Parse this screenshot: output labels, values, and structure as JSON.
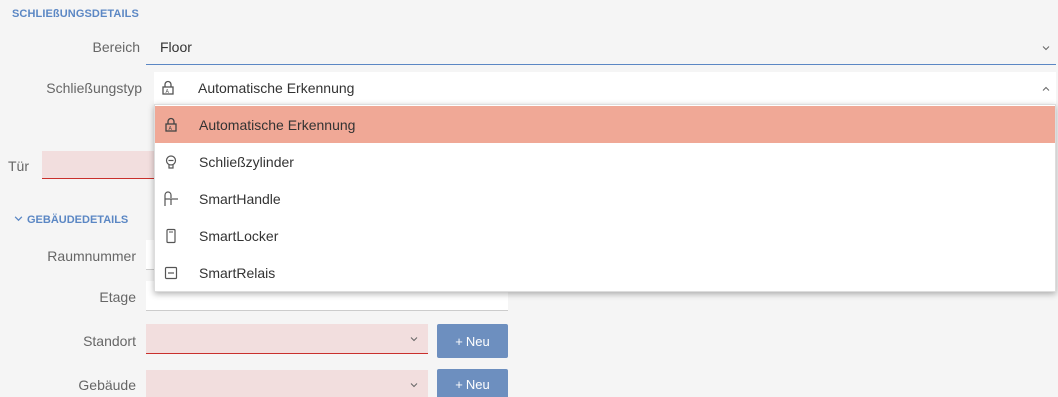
{
  "section_title": "SCHLIEßUNGSDETAILS",
  "bereich": {
    "label": "Bereich",
    "value": "Floor"
  },
  "schliessungstyp": {
    "label": "Schließungstyp",
    "value": "Automatische Erkennung"
  },
  "tuer": {
    "label": "Tür"
  },
  "gebaeudedetails": {
    "title": "GEBÄUDEDETAILS",
    "raumnummer_label": "Raumnummer",
    "etage_label": "Etage",
    "standort_label": "Standort",
    "gebaeude_label": "Gebäude",
    "neu_label": "Neu",
    "plus": "+"
  },
  "dropdown": {
    "items": [
      {
        "label": "Automatische Erkennung",
        "icon": "lock-auto-icon",
        "selected": true
      },
      {
        "label": "Schließzylinder",
        "icon": "cylinder-icon",
        "selected": false
      },
      {
        "label": "SmartHandle",
        "icon": "handle-icon",
        "selected": false
      },
      {
        "label": "SmartLocker",
        "icon": "locker-icon",
        "selected": false
      },
      {
        "label": "SmartRelais",
        "icon": "relais-icon",
        "selected": false
      }
    ]
  },
  "colors": {
    "accent": "#5b87c4",
    "selected": "#f0a896",
    "error_bg": "#f2dede",
    "error_line": "#c9302c",
    "button": "#6d8fbf"
  }
}
